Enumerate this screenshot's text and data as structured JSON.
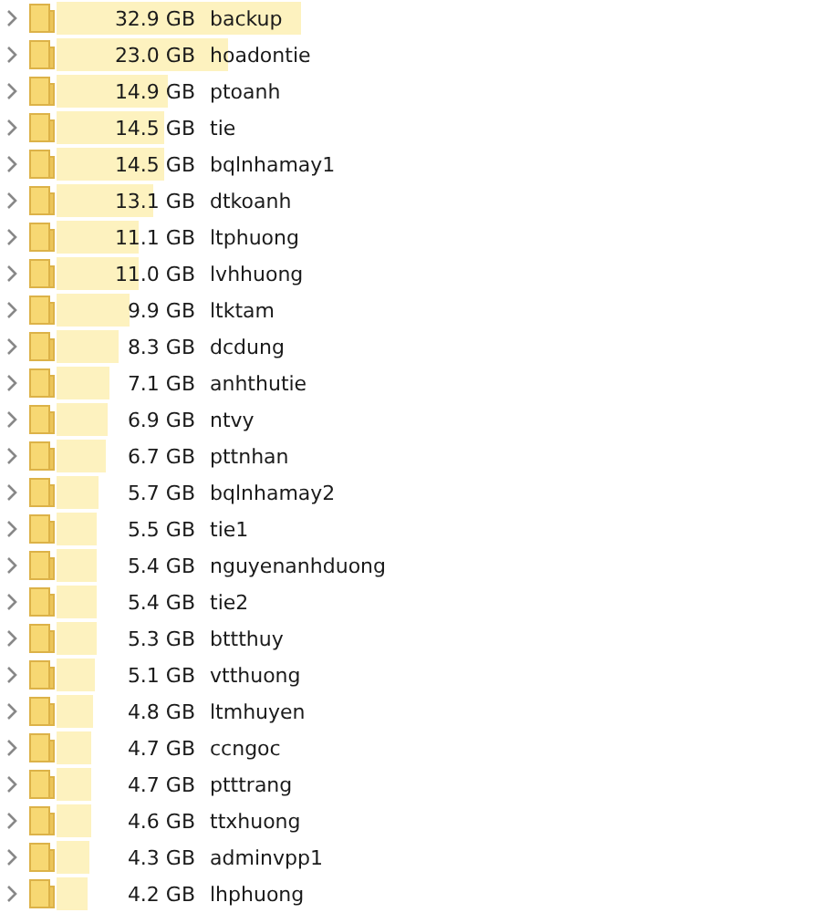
{
  "folders": [
    {
      "size": "32.9 GB",
      "name": "backup",
      "expanded": false
    },
    {
      "size": "23.0 GB",
      "name": "hoadontie",
      "expanded": false
    },
    {
      "size": "14.9 GB",
      "name": "ptoanh",
      "expanded": false
    },
    {
      "size": "14.5 GB",
      "name": "tie",
      "expanded": false
    },
    {
      "size": "14.5 GB",
      "name": "bqlnhamay1",
      "expanded": false
    },
    {
      "size": "13.1 GB",
      "name": "dtkoanh",
      "expanded": false
    },
    {
      "size": "11.1 GB",
      "name": "ltphuong",
      "expanded": false
    },
    {
      "size": "11.0 GB",
      "name": "lvhhuong",
      "expanded": false
    },
    {
      "size": "9.9 GB",
      "name": "ltktam",
      "expanded": false
    },
    {
      "size": "8.3 GB",
      "name": "dcdung",
      "expanded": false
    },
    {
      "size": "7.1 GB",
      "name": "anhthutie",
      "expanded": false
    },
    {
      "size": "6.9 GB",
      "name": "ntvy",
      "expanded": false
    },
    {
      "size": "6.7 GB",
      "name": "pttnhan",
      "expanded": false
    },
    {
      "size": "5.7 GB",
      "name": "bqlnhamay2",
      "expanded": false
    },
    {
      "size": "5.5 GB",
      "name": "tie1",
      "expanded": false
    },
    {
      "size": "5.4 GB",
      "name": "nguyenanhduong",
      "expanded": false
    },
    {
      "size": "5.4 GB",
      "name": "tie2",
      "expanded": false
    },
    {
      "size": "5.3 GB",
      "name": "bttthuy",
      "expanded": false
    },
    {
      "size": "5.1 GB",
      "name": "vtthuong",
      "expanded": false
    },
    {
      "size": "4.8 GB",
      "name": "ltmhuyen",
      "expanded": false
    },
    {
      "size": "4.7 GB",
      "name": "ccngoc",
      "expanded": false
    },
    {
      "size": "4.7 GB",
      "name": "ptttrang",
      "expanded": false
    },
    {
      "size": "4.6 GB",
      "name": "ttxhuong",
      "expanded": false
    },
    {
      "size": "4.3 GB",
      "name": "adminvpp1",
      "expanded": false
    },
    {
      "size": "4.2 GB",
      "name": "lhphuong",
      "expanded": false
    }
  ]
}
